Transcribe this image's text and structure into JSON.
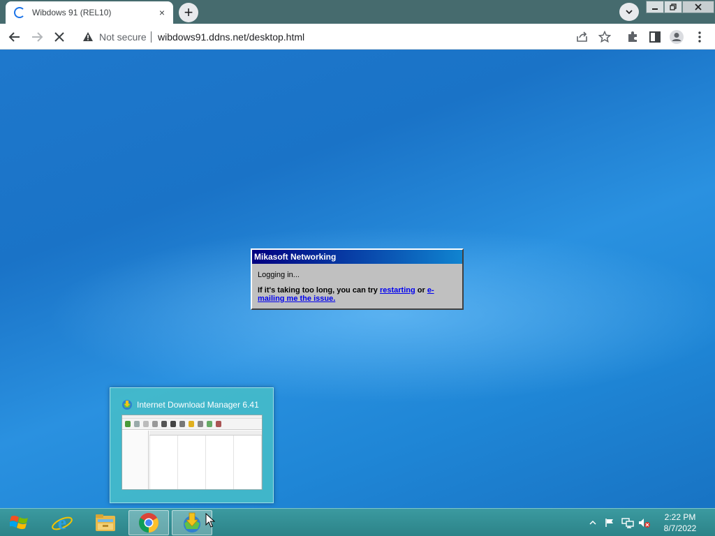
{
  "browser": {
    "tab": {
      "title": "Wibdows 91 (REL10)",
      "close_label": "×"
    },
    "newtab_label": "+",
    "address": {
      "security_label": "Not secure",
      "url": "wibdows91.ddns.net/desktop.html"
    },
    "icons": [
      "back-icon",
      "forward-icon",
      "stop-icon",
      "warning-icon",
      "share-icon",
      "star-icon",
      "extensions-icon",
      "sidepanel-icon",
      "profile-icon",
      "menu-icon"
    ]
  },
  "dialog": {
    "title": "Mikasoft Networking",
    "status": "Logging in...",
    "help_prefix": "If it's taking too long, you can try ",
    "restart_link": "restarting",
    "help_middle": " or ",
    "email_link": "e-mailing me the issue."
  },
  "preview": {
    "title": "Internet Download Manager 6.41"
  },
  "taskbar": {
    "apps": [
      "internet-explorer",
      "file-explorer",
      "chrome",
      "internet-download-manager"
    ],
    "clock": {
      "time": "2:22 PM",
      "date": "8/7/2022"
    },
    "tray_icons": [
      "show-hidden-icons-icon",
      "action-center-flag-icon",
      "network-icon",
      "volume-muted-icon"
    ]
  },
  "colors": {
    "tabstrip": "#466b6e",
    "taskbar": "#2f8a8f",
    "desktop": "#1d75c8",
    "dialog_title_start": "#000080",
    "dialog_title_end": "#1084d0"
  }
}
